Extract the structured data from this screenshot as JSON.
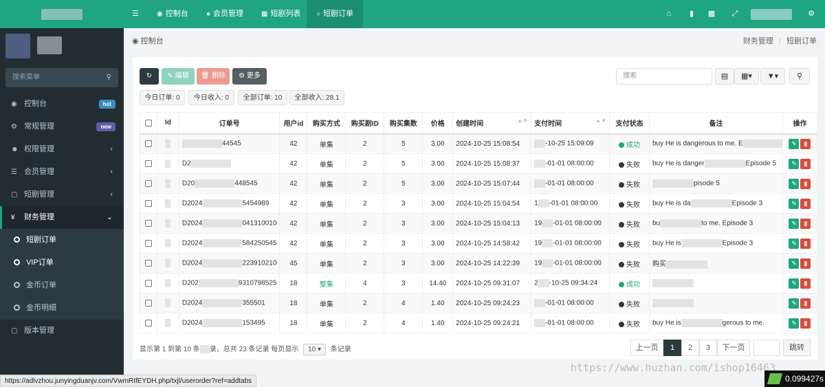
{
  "sidebar": {
    "search_placeholder": "搜索菜单",
    "items": [
      {
        "label": "控制台",
        "icon": "dashboard-icon",
        "badge": "hot",
        "badge_color": "#3c8dbc"
      },
      {
        "label": "常规管理",
        "icon": "cogs-icon",
        "badge": "new",
        "badge_color": "#605ca8"
      },
      {
        "label": "权限管理",
        "icon": "users-icon"
      },
      {
        "label": "会员管理",
        "icon": "list-icon"
      },
      {
        "label": "短剧管理",
        "icon": "file-icon"
      },
      {
        "label": "财务管理",
        "icon": "yen-icon"
      }
    ],
    "sub_items": [
      {
        "label": "短剧订单"
      },
      {
        "label": "VIP订单"
      },
      {
        "label": "金币订单"
      },
      {
        "label": "金币明细"
      }
    ],
    "last_item": {
      "label": "版本管理",
      "icon": "file-icon"
    }
  },
  "topnav": {
    "tabs": [
      {
        "label": "控制台",
        "icon": "dashboard-icon"
      },
      {
        "label": "会员管理",
        "icon": "user-icon"
      },
      {
        "label": "短剧列表",
        "icon": "file-icon"
      },
      {
        "label": "短剧订单",
        "icon": "circle-icon"
      }
    ]
  },
  "breadcrumb": {
    "page": "控制台",
    "path": [
      "财务管理",
      "短剧订单"
    ]
  },
  "toolbar": {
    "edit_label": "编辑",
    "delete_label": "删除",
    "more_label": "更多",
    "search_placeholder": "搜索"
  },
  "stats": [
    {
      "label": "今日订单: 0"
    },
    {
      "label": "今日收入: 0"
    },
    {
      "label": "全部订单: 10"
    },
    {
      "label": "全部收入: 28.1"
    }
  ],
  "table": {
    "columns": [
      "Id",
      "订单号",
      "用户id",
      "购买方式",
      "购买剧ID",
      "购买集数",
      "价格",
      "创建时间",
      "支付时间",
      "支付状态",
      "备注",
      "操作"
    ],
    "rows": [
      {
        "order_pre": "",
        "order_suf": "44545",
        "uid": "42",
        "mode": "单集",
        "drama": "2",
        "ep": "5",
        "price": "3.00",
        "created": "2024-10-25 15:08:54",
        "paid_pre": "",
        "paid_suf": "-10-25 15:09:09",
        "status": "成功",
        "ok": true,
        "note_pre": "buy He is dangerous to me. E",
        "note_suf": ""
      },
      {
        "order_pre": "D2",
        "order_suf": "",
        "uid": "42",
        "mode": "单集",
        "drama": "2",
        "ep": "5",
        "price": "3.00",
        "created": "2024-10-25 15:08:37",
        "paid_pre": "",
        "paid_suf": "-01-01 08:00:00",
        "status": "失败",
        "ok": false,
        "note_pre": "buy He is danger",
        "note_suf": "Episode 5"
      },
      {
        "order_pre": "D20",
        "order_suf": "448545",
        "uid": "42",
        "mode": "单集",
        "drama": "2",
        "ep": "5",
        "price": "3.00",
        "created": "2024-10-25 15:07:44",
        "paid_pre": "",
        "paid_suf": "-01-01 08:00:00",
        "status": "失败",
        "ok": false,
        "note_pre": "",
        "note_suf": "pisode 5"
      },
      {
        "order_pre": "D2024",
        "order_suf": "5454989",
        "uid": "42",
        "mode": "单集",
        "drama": "2",
        "ep": "3",
        "price": "3.00",
        "created": "2024-10-25 15:04:54",
        "paid_pre": "1",
        "paid_suf": "-01-01 08:00:00",
        "status": "失败",
        "ok": false,
        "note_pre": "buy He is da",
        "note_suf": "Episode 3"
      },
      {
        "order_pre": "D2024",
        "order_suf": "041310010",
        "uid": "42",
        "mode": "单集",
        "drama": "2",
        "ep": "3",
        "price": "3.00",
        "created": "2024-10-25 15:04:13",
        "paid_pre": "19",
        "paid_suf": "-01-01 08:00:00",
        "status": "失败",
        "ok": false,
        "note_pre": "bu",
        "note_suf": "to me. Episode 3"
      },
      {
        "order_pre": "D2024",
        "order_suf": "584250545",
        "uid": "42",
        "mode": "单集",
        "drama": "2",
        "ep": "3",
        "price": "3.00",
        "created": "2024-10-25 14:58:42",
        "paid_pre": "19",
        "paid_suf": "-01-01 08:00:00",
        "status": "失败",
        "ok": false,
        "note_pre": "buy He is",
        "note_suf": "Episode 3"
      },
      {
        "order_pre": "D2024",
        "order_suf": "223910210",
        "uid": "45",
        "mode": "单集",
        "drama": "2",
        "ep": "3",
        "price": "3.00",
        "created": "2024-10-25 14:22:39",
        "paid_pre": "19",
        "paid_suf": "-01-01 08:00:00",
        "status": "失败",
        "ok": false,
        "note_pre": "购买",
        "note_suf": ""
      },
      {
        "order_pre": "D202",
        "order_suf": "9310798525",
        "uid": "18",
        "mode": "整集",
        "drama": "4",
        "ep": "3",
        "price": "14.40",
        "created": "2024-10-25 09:31:07",
        "paid_pre": "2",
        "paid_suf": "-10-25 09:34:24",
        "status": "成功",
        "ok": true,
        "note_pre": "",
        "note_suf": ""
      },
      {
        "order_pre": "D2024",
        "order_suf": "355501",
        "uid": "18",
        "mode": "单集",
        "drama": "2",
        "ep": "4",
        "price": "1.40",
        "created": "2024-10-25 09:24:23",
        "paid_pre": "",
        "paid_suf": "-01-01 08:00:00",
        "status": "失败",
        "ok": false,
        "note_pre": "",
        "note_suf": ""
      },
      {
        "order_pre": "D2024",
        "order_suf": "153495",
        "uid": "18",
        "mode": "单集",
        "drama": "2",
        "ep": "4",
        "price": "1.40",
        "created": "2024-10-25 09:24:21",
        "paid_pre": "",
        "paid_suf": "-01-01 08:00:00",
        "status": "失败",
        "ok": false,
        "note_pre": "buy He is",
        "note_suf": "gerous to me."
      }
    ]
  },
  "pagination": {
    "summary_pre": "显示第 1 到第 10 条",
    "summary_mid": "录，总共 23 条记录 每页显示",
    "page_size": "10",
    "summary_post": "条记录",
    "prev": "上一页",
    "pages": [
      "1",
      "2",
      "3"
    ],
    "next": "下一页",
    "jump": "跳转"
  },
  "status_url": "https://adlvzhou.junyingduanjv.com/VwmRIfEYDH.php/txjl/userorder?ref=addtabs",
  "watermark": "https://www.huzhan.com/ishop16463",
  "timer": "0.099427s",
  "colors": {
    "accent": "#1fa57f",
    "danger": "#dd4b39",
    "dark": "#222d32"
  }
}
